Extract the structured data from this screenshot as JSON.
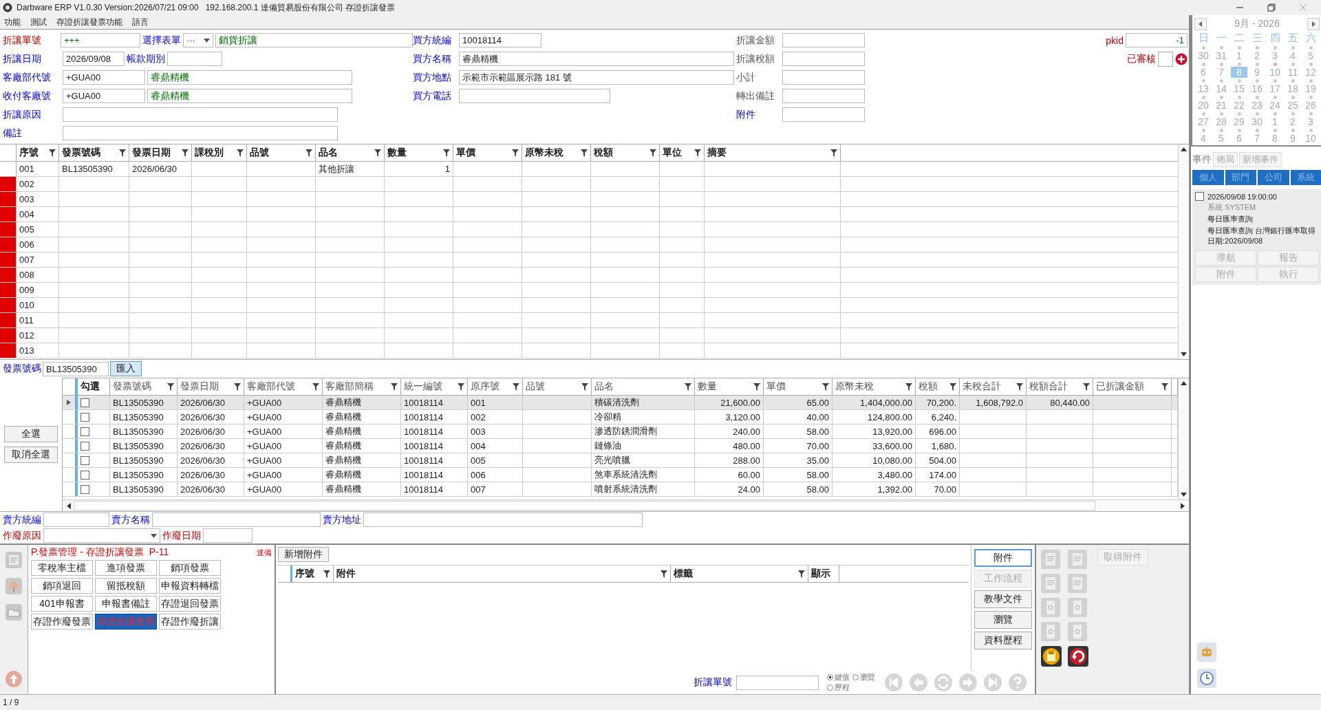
{
  "window": {
    "title": "Darbware ERP V1.0.30 Version:2026/07/21 09:00   192.168.200.1 達備貿易股份有限公司 存證折讓發票"
  },
  "menu": [
    "功能",
    "測試",
    "存證折讓發票功能",
    "語言"
  ],
  "form": {
    "groups": [
      {
        "rows": [
          {
            "items": [
              {
                "kind": "required",
                "text": "折讓單號"
              },
              {
                "kind": "code",
                "value": "+++"
              },
              {
                "kind": "link",
                "text": "選擇表單"
              },
              {
                "kind": "combo",
                "value": "···"
              },
              {
                "kind": "name",
                "value": "銷貨折讓"
              }
            ]
          },
          {
            "items": [
              {
                "kind": "link",
                "text": "折讓日期"
              },
              {
                "kind": "date",
                "value": "2026/09/08"
              },
              {
                "kind": "link",
                "text": "帳款期別"
              },
              {
                "kind": "period"
              }
            ]
          },
          {
            "items": [
              {
                "kind": "link",
                "text": "客廠部代號"
              },
              {
                "kind": "text",
                "value": "+GUA00"
              },
              {
                "kind": "name",
                "value": "睿鼎精機"
              }
            ]
          },
          {
            "items": [
              {
                "kind": "link",
                "text": "收付客廠號"
              },
              {
                "kind": "text",
                "value": "+GUA00"
              },
              {
                "kind": "name",
                "value": "睿鼎精機"
              }
            ]
          },
          {
            "items": [
              {
                "kind": "link",
                "text": "折讓原因"
              },
              {
                "kind": "long"
              }
            ]
          },
          {
            "items": [
              {
                "kind": "link",
                "text": "備註"
              },
              {
                "kind": "long"
              }
            ]
          }
        ]
      },
      {
        "rows": [
          {
            "items": [
              {
                "kind": "link",
                "text": "買方統編"
              },
              {
                "kind": "text",
                "value": "10018114"
              }
            ]
          },
          {
            "items": [
              {
                "kind": "link",
                "text": "買方名稱"
              },
              {
                "kind": "wide",
                "value": "睿鼎精機"
              }
            ]
          },
          {
            "items": [
              {
                "kind": "link",
                "text": "買方地點"
              },
              {
                "kind": "wide",
                "value": "示範市示範區展示路 181 號"
              }
            ]
          },
          {
            "items": [
              {
                "kind": "link",
                "text": "買方電話"
              },
              {
                "kind": "medium"
              }
            ]
          }
        ]
      },
      {
        "rows": [
          {
            "items": [
              {
                "kind": "plain",
                "text": "折讓金額"
              },
              {
                "kind": "total"
              }
            ]
          },
          {
            "items": [
              {
                "kind": "plain",
                "text": "折讓稅額"
              },
              {
                "kind": "total"
              }
            ]
          },
          {
            "items": [
              {
                "kind": "plain",
                "text": "小計"
              },
              {
                "kind": "total"
              }
            ]
          },
          {
            "items": [
              {
                "kind": "plain",
                "text": "轉出備註"
              },
              {
                "kind": "total"
              }
            ]
          },
          {
            "items": [
              {
                "kind": "link",
                "text": "附件"
              },
              {
                "kind": "total"
              }
            ]
          }
        ]
      },
      {
        "rows": [
          {
            "items": [
              {
                "kind": "required",
                "text": "pkid"
              },
              {
                "kind": "pkid",
                "value": "-1"
              }
            ]
          },
          {
            "items": [
              {
                "kind": "required",
                "text": "已審核"
              },
              {
                "kind": "checkbox",
                "checked": false
              },
              {
                "kind": "add"
              }
            ]
          }
        ]
      }
    ]
  },
  "lines": {
    "columns": [
      {
        "label": "序號",
        "kind": "text"
      },
      {
        "label": "發票號碼",
        "kind": "text"
      },
      {
        "label": "發票日期",
        "kind": "text"
      },
      {
        "label": "課稅別",
        "kind": "text"
      },
      {
        "label": "品號",
        "kind": "text"
      },
      {
        "label": "品名",
        "kind": "text"
      },
      {
        "label": "數量",
        "kind": "number"
      },
      {
        "label": "單價",
        "kind": "number"
      },
      {
        "label": "原幣未稅",
        "kind": "number"
      },
      {
        "label": "稅額",
        "kind": "number"
      },
      {
        "label": "單位",
        "kind": "text"
      },
      {
        "label": "摘要",
        "kind": "text"
      }
    ],
    "rows": [
      {
        "flagged": false,
        "cells": [
          "001",
          "BL13505390",
          "2026/06/30",
          null,
          null,
          "其他折讓",
          "1"
        ]
      },
      {
        "flagged": true,
        "cells": [
          "002"
        ]
      },
      {
        "flagged": true,
        "cells": [
          "003"
        ]
      },
      {
        "flagged": true,
        "cells": [
          "004"
        ]
      },
      {
        "flagged": true,
        "cells": [
          "005"
        ]
      },
      {
        "flagged": true,
        "cells": [
          "006"
        ]
      },
      {
        "flagged": true,
        "cells": [
          "007"
        ]
      },
      {
        "flagged": true,
        "cells": [
          "008"
        ]
      },
      {
        "flagged": true,
        "cells": [
          "009"
        ]
      },
      {
        "flagged": true,
        "cells": [
          "010"
        ]
      },
      {
        "flagged": true,
        "cells": [
          "011"
        ]
      },
      {
        "flagged": true,
        "cells": [
          "012"
        ]
      },
      {
        "flagged": true,
        "cells": [
          "013"
        ]
      }
    ]
  },
  "invoice_lookup": {
    "label": "發票號碼",
    "value": "BL13505390",
    "button": "匯入"
  },
  "select_buttons": [
    "全選",
    "取消全選"
  ],
  "invoice_items": {
    "check_column": "勾選",
    "columns": [
      {
        "label": "發票號碼",
        "kind": "text"
      },
      {
        "label": "發票日期",
        "kind": "text"
      },
      {
        "label": "客廠部代號",
        "kind": "text"
      },
      {
        "label": "客廠部簡稱",
        "kind": "text"
      },
      {
        "label": "統一編號",
        "kind": "text"
      },
      {
        "label": "原序號",
        "kind": "text"
      },
      {
        "label": "品號",
        "kind": "text"
      },
      {
        "label": "品名",
        "kind": "text"
      },
      {
        "label": "數量",
        "kind": "number"
      },
      {
        "label": "單價",
        "kind": "number"
      },
      {
        "label": "原幣未稅",
        "kind": "number"
      },
      {
        "label": "稅額",
        "kind": "number"
      },
      {
        "label": "未稅合計",
        "kind": "number"
      },
      {
        "label": "稅額合計",
        "kind": "number"
      },
      {
        "label": "已折讓金額",
        "kind": "number"
      }
    ],
    "rows": [
      {
        "selected": true,
        "checked": false,
        "cells": [
          "BL13505390",
          "2026/06/30",
          "+GUA00",
          "睿鼎精機",
          "10018114",
          "001",
          null,
          "積碳清洗劑",
          "21,600.00",
          "65.00",
          "1,404,000.00",
          "70,200.",
          "1,608,792.0",
          "80,440.00"
        ]
      },
      {
        "selected": false,
        "checked": false,
        "cells": [
          "BL13505390",
          "2026/06/30",
          "+GUA00",
          "睿鼎精機",
          "10018114",
          "002",
          null,
          "冷卻精",
          "3,120.00",
          "40.00",
          "124,800.00",
          "6,240."
        ]
      },
      {
        "selected": false,
        "checked": false,
        "cells": [
          "BL13505390",
          "2026/06/30",
          "+GUA00",
          "睿鼎精機",
          "10018114",
          "003",
          null,
          "滲透防銹潤滑劑",
          "240.00",
          "58.00",
          "13,920.00",
          "696.00"
        ]
      },
      {
        "selected": false,
        "checked": false,
        "cells": [
          "BL13505390",
          "2026/06/30",
          "+GUA00",
          "睿鼎精機",
          "10018114",
          "004",
          null,
          "鏈條油",
          "480.00",
          "70.00",
          "33,600.00",
          "1,680."
        ]
      },
      {
        "selected": false,
        "checked": false,
        "cells": [
          "BL13505390",
          "2026/06/30",
          "+GUA00",
          "睿鼎精機",
          "10018114",
          "005",
          null,
          "亮光噴臘",
          "288.00",
          "35.00",
          "10,080.00",
          "504.00"
        ]
      },
      {
        "selected": false,
        "checked": false,
        "cells": [
          "BL13505390",
          "2026/06/30",
          "+GUA00",
          "睿鼎精機",
          "10018114",
          "006",
          null,
          "煞車系統清洗劑",
          "60.00",
          "58.00",
          "3,480.00",
          "174.00"
        ]
      },
      {
        "selected": false,
        "checked": false,
        "cells": [
          "BL13505390",
          "2026/06/30",
          "+GUA00",
          "睿鼎精機",
          "10018114",
          "007",
          null,
          "噴射系統清洗劑",
          "24.00",
          "58.00",
          "1,392.00",
          "70.00"
        ]
      }
    ]
  },
  "seller": [
    {
      "label": "賣方統編",
      "kind": "link"
    },
    {
      "label": "賣方名稱",
      "kind": "link"
    },
    {
      "label": "賣方地址",
      "kind": "link"
    }
  ],
  "void": [
    {
      "label": "作廢原因",
      "kind": "required"
    },
    {
      "label": "作廢日期",
      "kind": "required"
    }
  ],
  "module": {
    "title": "P.發票管理 - 存證折讓發票  P-11",
    "tag": "達備",
    "buttons": [
      {
        "label": "零稅率主檔",
        "selected": false
      },
      {
        "label": "進項發票",
        "selected": false
      },
      {
        "label": "銷項發票",
        "selected": false
      },
      {
        "label": "銷項退回",
        "selected": false
      },
      {
        "label": "留抵稅額",
        "selected": false
      },
      {
        "label": "申報資料轉檔",
        "selected": false
      },
      {
        "label": "401申報書",
        "selected": false
      },
      {
        "label": "申報書備註",
        "selected": false
      },
      {
        "label": "存證退回發票",
        "selected": false
      },
      {
        "label": "存證作廢發票",
        "selected": false
      },
      {
        "label": "存證折讓發票",
        "selected": true
      },
      {
        "label": "存證作廢折讓",
        "selected": false
      }
    ]
  },
  "attachments": {
    "add_button": "新增附件",
    "columns": [
      {
        "label": "序號",
        "filter": true
      },
      {
        "label": "附件",
        "filter": true
      },
      {
        "label": "標籤",
        "filter": true
      },
      {
        "label": "顯示",
        "filter": false
      }
    ],
    "side_buttons": [
      {
        "label": "附件",
        "selected": true,
        "disabled": false
      },
      {
        "label": "工作流程",
        "selected": false,
        "disabled": true
      },
      {
        "label": "教學文件",
        "selected": false,
        "disabled": false
      },
      {
        "label": "瀏覽",
        "selected": false,
        "disabled": false
      },
      {
        "label": "資料歷程",
        "selected": false,
        "disabled": false
      }
    ],
    "lookup_label": "折讓單號",
    "modes": [
      {
        "label": "鍵值",
        "selected": true
      },
      {
        "label": "瀏覽",
        "selected": false
      },
      {
        "label": "歷程",
        "selected": false
      }
    ],
    "fetch_button": "取得附件"
  },
  "calendar": {
    "title": "9月 - 2026",
    "weekdays": [
      "日",
      "一",
      "二",
      "三",
      "四",
      "五",
      "六"
    ],
    "weeks": [
      [
        {
          "d": "30",
          "selected": false,
          "event": false
        },
        {
          "d": "31",
          "selected": false,
          "event": false
        },
        {
          "d": "1",
          "selected": false,
          "event": false
        },
        {
          "d": "2",
          "selected": false,
          "event": false
        },
        {
          "d": "3",
          "selected": false,
          "event": false
        },
        {
          "d": "4",
          "selected": false,
          "event": false
        },
        {
          "d": "5",
          "selected": false,
          "event": false
        }
      ],
      [
        {
          "d": "6",
          "selected": false,
          "event": false
        },
        {
          "d": "7",
          "selected": false,
          "event": false
        },
        {
          "d": "8",
          "selected": true,
          "event": false
        },
        {
          "d": "9",
          "selected": false,
          "event": false
        },
        {
          "d": "10",
          "selected": false,
          "event": true
        },
        {
          "d": "11",
          "selected": false,
          "event": false
        },
        {
          "d": "12",
          "selected": false,
          "event": false
        }
      ],
      [
        {
          "d": "13",
          "selected": false,
          "event": false
        },
        {
          "d": "14",
          "selected": false,
          "event": false
        },
        {
          "d": "15",
          "selected": false,
          "event": false
        },
        {
          "d": "16",
          "selected": false,
          "event": false
        },
        {
          "d": "17",
          "selected": false,
          "event": false
        },
        {
          "d": "18",
          "selected": false,
          "event": false
        },
        {
          "d": "19",
          "selected": false,
          "event": false
        }
      ],
      [
        {
          "d": "20",
          "selected": false,
          "event": false
        },
        {
          "d": "21",
          "selected": false,
          "event": false
        },
        {
          "d": "22",
          "selected": false,
          "event": false
        },
        {
          "d": "23",
          "selected": false,
          "event": false
        },
        {
          "d": "24",
          "selected": false,
          "event": false
        },
        {
          "d": "25",
          "selected": false,
          "event": false
        },
        {
          "d": "26",
          "selected": false,
          "event": false
        }
      ],
      [
        {
          "d": "27",
          "selected": false,
          "event": false
        },
        {
          "d": "28",
          "selected": false,
          "event": false
        },
        {
          "d": "29",
          "selected": false,
          "event": false
        },
        {
          "d": "30",
          "selected": false,
          "event": false
        },
        {
          "d": "1",
          "selected": false,
          "event": false
        },
        {
          "d": "2",
          "selected": false,
          "event": false
        },
        {
          "d": "3",
          "selected": false,
          "event": false
        }
      ],
      [
        {
          "d": "4",
          "selected": false,
          "event": false
        },
        {
          "d": "5",
          "selected": false,
          "event": false
        },
        {
          "d": "6",
          "selected": false,
          "event": false
        },
        {
          "d": "7",
          "selected": false,
          "event": false
        },
        {
          "d": "8",
          "selected": false,
          "event": false
        },
        {
          "d": "9",
          "selected": false,
          "event": false
        },
        {
          "d": "10",
          "selected": false,
          "event": false
        }
      ]
    ]
  },
  "events": {
    "label": "事件",
    "actions": [
      "佈局",
      "新增事件"
    ],
    "categories": [
      "個人",
      "部門",
      "公司",
      "系統"
    ],
    "items": [
      {
        "checked": false,
        "time": "2026/09/08 19:00:00",
        "source": "系統 SYSTEM",
        "title": "每日匯率查詢",
        "description": "每日匯率查詢 台灣銀行匯率取得日期:2026/09/08",
        "buttons": [
          "導航",
          "報告",
          "附件",
          "執行"
        ]
      }
    ]
  },
  "status_bar": "1 / 9"
}
